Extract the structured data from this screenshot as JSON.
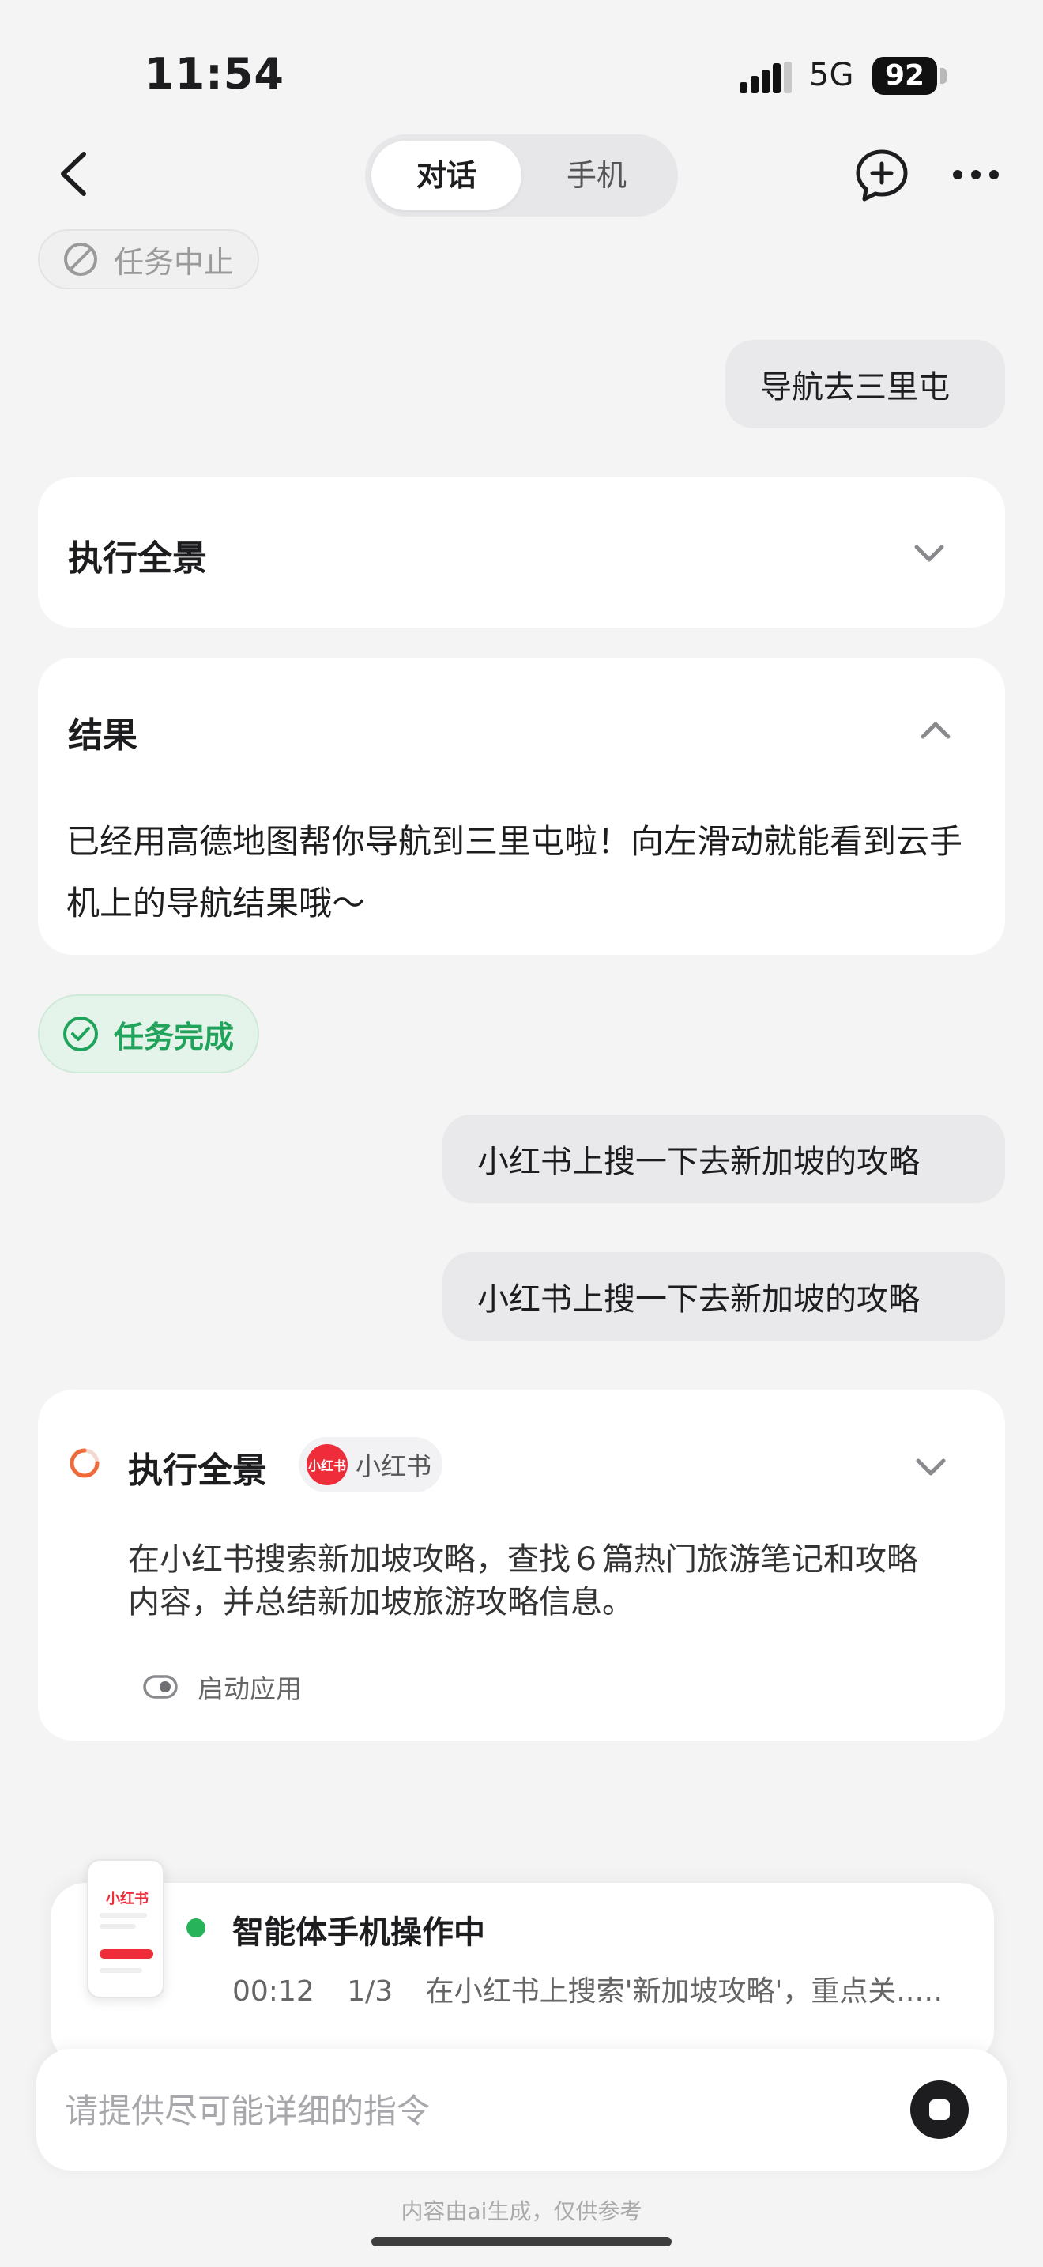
{
  "status_bar": {
    "time": "11:54",
    "network": "5G",
    "battery": "92"
  },
  "nav": {
    "tabs": [
      {
        "label": "对话",
        "active": true
      },
      {
        "label": "手机",
        "active": false
      }
    ]
  },
  "messages": {
    "stopped_chip": "任务中止",
    "user_msg_1": "导航去三里屯",
    "overview_card": {
      "title": "执行全景"
    },
    "result_card": {
      "title": "结果",
      "text": "已经用高德地图帮你导航到三里屯啦！向左滑动就能看到云手机上的导航结果哦～"
    },
    "done_chip": "任务完成",
    "user_msg_2": "小红书上搜一下去新加坡的攻略",
    "user_msg_3": "小红书上搜一下去新加坡的攻略",
    "running_card": {
      "title": "执行全景",
      "app_badge": "小红书",
      "app_logo_text": "小红书",
      "description": "在小红书搜索新加坡攻略，查找６篇热门旅游笔记和攻略内容，并总结新加坡旅游攻略信息。",
      "step": "启动应用"
    }
  },
  "agent_status": {
    "thumb_logo": "小红书",
    "title": "智能体手机操作中",
    "elapsed": "00:12",
    "progress": "1/3",
    "current_step": "在小红书上搜索'新加坡攻略'，重点关..."
  },
  "composer": {
    "placeholder": "请提供尽可能详细的指令",
    "value": ""
  },
  "footer": {
    "disclaimer": "内容由ai生成，仅供参考"
  },
  "colors": {
    "accent_green": "#20a35a",
    "brand_red": "#ef2d3a",
    "page_bg": "#f4f4f5"
  }
}
